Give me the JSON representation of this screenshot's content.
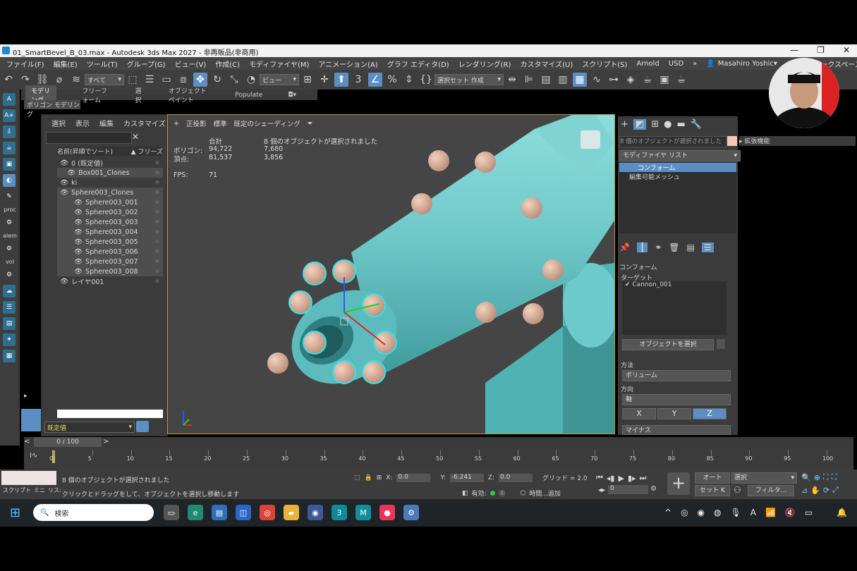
{
  "window": {
    "title": "01_SmartBevel_B_03.max - Autodesk 3ds Max 2027 - 非再販品(非商用)",
    "user": "Masahiro Yoshic▾",
    "time_value": "30",
    "workspace_label": "ワークスペース:"
  },
  "menu": [
    "ファイル(F)",
    "編集(E)",
    "ツール(T)",
    "グループ(G)",
    "ビュー(V)",
    "作成(C)",
    "モディファイヤ(M)",
    "アニメーション(A)",
    "グラフ エディタ(D)",
    "レンダリング(R)",
    "カスタマイズ(U)",
    "スクリプト(S)",
    "Arnold",
    "USD"
  ],
  "toolbar": {
    "selection_filter": "すべて",
    "ref_coord": "ビュー",
    "named_selection": "選択セット 作成"
  },
  "ribbon": {
    "tabs": [
      "モデリング",
      "フリーフォーム",
      "選択",
      "オブジェクト ペイント",
      "Populate"
    ],
    "subtab": "ポリゴン モデリング"
  },
  "left_strip": {
    "proc_label": "proc",
    "alem_label": "alem",
    "vol_label": "vol"
  },
  "explorer": {
    "menu": [
      "選択",
      "表示",
      "編集",
      "カスタマイズ"
    ],
    "column_name": "名前(昇順でソート)",
    "column_freeze": "▲ フリーズ",
    "rows": [
      {
        "label": "0 (既定値)",
        "selected": false,
        "indent": 0
      },
      {
        "label": "Box001_Clones",
        "selected": true,
        "indent": 1
      },
      {
        "label": "ki",
        "selected": false,
        "indent": 0
      },
      {
        "label": "Sphere003_Clones",
        "selected": true,
        "indent": 0
      },
      {
        "label": "Sphere003_001",
        "selected": true,
        "indent": 2
      },
      {
        "label": "Sphere003_002",
        "selected": true,
        "indent": 2
      },
      {
        "label": "Sphere003_003",
        "selected": true,
        "indent": 2
      },
      {
        "label": "Sphere003_004",
        "selected": true,
        "indent": 2
      },
      {
        "label": "Sphere003_005",
        "selected": true,
        "indent": 2
      },
      {
        "label": "Sphere003_006",
        "selected": true,
        "indent": 2
      },
      {
        "label": "Sphere003_007",
        "selected": true,
        "indent": 2
      },
      {
        "label": "Sphere003_008",
        "selected": true,
        "indent": 2
      },
      {
        "label": "レイヤ001",
        "selected": false,
        "indent": 0
      }
    ],
    "layer_dropdown": "既定値"
  },
  "viewport": {
    "labels": [
      "+",
      "正投影",
      "標準",
      "既定のシェーディング"
    ],
    "stats": {
      "total_label": "合計",
      "selected_label": "8 個のオブジェクトが選択されました",
      "poly_label": "ポリゴン:",
      "poly_total": "94,722",
      "poly_sel": "7,680",
      "vert_label": "頂点:",
      "vert_total": "81,537",
      "vert_sel": "3,856",
      "fps_label": "FPS:",
      "fps": "71"
    }
  },
  "command_panel": {
    "selection_info": "8 個のオブジェクトが選択されました",
    "ext_label": "拡張機能",
    "modifier_list": "モディファイヤ リスト",
    "stack": [
      "コンフォーム",
      "編集可能メッシュ"
    ],
    "rollout_title": "コンフォーム",
    "target_label": "ターゲット",
    "target_item": "Cannon_001",
    "select_object_btn": "オブジェクトを選択",
    "method_label": "方法",
    "method_value": "ボリューム",
    "direction_label": "方向",
    "direction_value": "軸",
    "axes": [
      "X",
      "Y",
      "Z"
    ],
    "minus_label": "マイナス"
  },
  "timeline": {
    "frame_label": "0 / 100",
    "ticks": [
      "0",
      "5",
      "10",
      "15",
      "20",
      "25",
      "30",
      "35",
      "40",
      "45",
      "50",
      "55",
      "60",
      "65",
      "70",
      "75",
      "80",
      "85",
      "90",
      "95",
      "100"
    ]
  },
  "status": {
    "script_labels": [
      "スクリプト",
      "ミニ",
      "リス:"
    ],
    "selection_msg": "8 個のオブジェクトが選択されました",
    "prompt_msg": "クリックとドラッグをして、オブジェクトを選択し移動します",
    "x_label": "X:",
    "x_value": "0.0",
    "y_label": "Y:",
    "y_value": "-6.241",
    "z_label": "Z:",
    "z_value": "0.0",
    "grid_label": "グリッド = 2.0",
    "enabled_label": "有効:",
    "time_label": "時間...追加",
    "auto_label": "オート",
    "setkey_label": "セット K",
    "select_dd": "選択",
    "filter_label": "フィルタ...",
    "frame_field": "0"
  },
  "taskbar": {
    "search_placeholder": "検索"
  }
}
